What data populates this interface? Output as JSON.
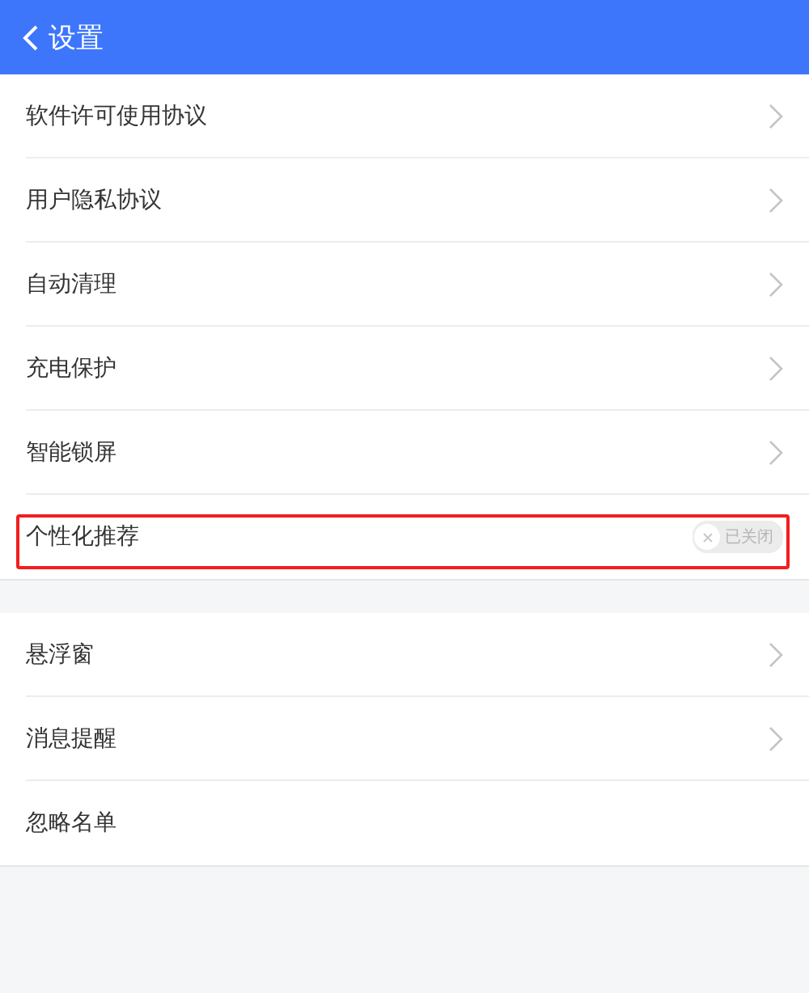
{
  "header": {
    "title": "设置"
  },
  "sections": [
    {
      "items": [
        {
          "kind": "link",
          "label": "软件许可使用协议",
          "highlighted": false
        },
        {
          "kind": "link",
          "label": "用户隐私协议",
          "highlighted": false
        },
        {
          "kind": "link",
          "label": "自动清理",
          "highlighted": false
        },
        {
          "kind": "link",
          "label": "充电保护",
          "highlighted": false
        },
        {
          "kind": "link",
          "label": "智能锁屏",
          "highlighted": false
        },
        {
          "kind": "switch",
          "label": "个性化推荐",
          "on": false,
          "state_text": "已关闭",
          "highlighted": true
        }
      ]
    },
    {
      "items": [
        {
          "kind": "link",
          "label": "悬浮窗",
          "highlighted": false
        },
        {
          "kind": "link",
          "label": "消息提醒",
          "highlighted": false
        },
        {
          "kind": "plain",
          "label": "忽略名单",
          "highlighted": false
        }
      ]
    }
  ]
}
